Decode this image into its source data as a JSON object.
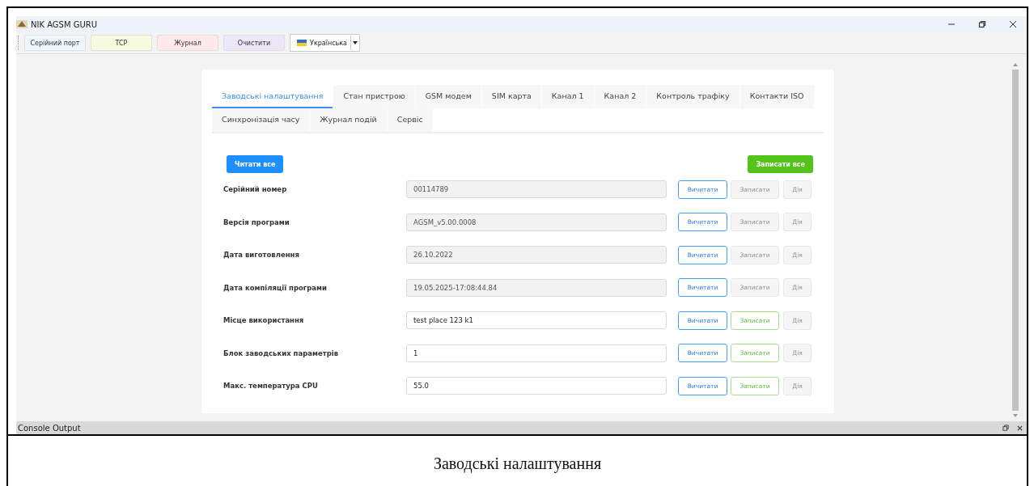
{
  "window": {
    "title": "NIK AGSM GURU"
  },
  "toolbar": [
    {
      "label": "Серійний порт",
      "kind": "blue"
    },
    {
      "label": "TCP",
      "kind": "yellow"
    },
    {
      "label": "Журнал",
      "kind": "red"
    },
    {
      "label": "Очистити",
      "kind": "purple"
    }
  ],
  "language": {
    "value": "Українська"
  },
  "tabs": [
    {
      "label": "Заводські налаштування",
      "selected": true
    },
    {
      "label": "Стан пристрою",
      "selected": false
    },
    {
      "label": "GSM модем",
      "selected": false
    },
    {
      "label": "SIM карта",
      "selected": false
    },
    {
      "label": "Канал 1",
      "selected": false
    },
    {
      "label": "Канал 2",
      "selected": false
    },
    {
      "label": "Контроль трафіку",
      "selected": false
    },
    {
      "label": "Контакти ISO",
      "selected": false
    },
    {
      "label": "Синхронізація часу",
      "selected": false
    },
    {
      "label": "Журнал подій",
      "selected": false
    },
    {
      "label": "Сервіс",
      "selected": false
    }
  ],
  "read_all": "Читати все",
  "write_all": "Записати все",
  "rows": [
    {
      "label": "Серійний номер",
      "value": "00114789",
      "disabled": true,
      "read": "Вичитати",
      "write": "Записати",
      "write_disabled": true,
      "action": "Дія",
      "action_disabled": true
    },
    {
      "label": "Версія програми",
      "value": "AGSM_v5.00.0008",
      "disabled": true,
      "read": "Вичитати",
      "write": "Записати",
      "write_disabled": true,
      "action": "Дія",
      "action_disabled": true
    },
    {
      "label": "Дата виготовлення",
      "value": "26.10.2022",
      "disabled": true,
      "read": "Вичитати",
      "write": "Записати",
      "write_disabled": true,
      "action": "Дія",
      "action_disabled": true
    },
    {
      "label": "Дата компіляції програми",
      "value": "19.05.2025-17:08:44.84",
      "disabled": true,
      "read": "Вичитати",
      "write": "Записати",
      "write_disabled": true,
      "action": "Дія",
      "action_disabled": true
    },
    {
      "label": "Місце використання",
      "value": "test place 123 k1",
      "disabled": false,
      "read": "Вичитати",
      "write": "Записати",
      "write_disabled": false,
      "action": "Дія",
      "action_disabled": true
    },
    {
      "label": "Блок заводських параметрів",
      "value": "1",
      "disabled": false,
      "read": "Вичитати",
      "write": "Записати",
      "write_disabled": false,
      "action": "Дія",
      "action_disabled": true
    },
    {
      "label": "Макс. температура CPU",
      "value": "55.0",
      "disabled": false,
      "read": "Вичитати",
      "write": "Записати",
      "write_disabled": false,
      "action": "Дія",
      "action_disabled": true
    }
  ],
  "console": {
    "title": "Console Output"
  },
  "caption": "Заводські налаштування"
}
